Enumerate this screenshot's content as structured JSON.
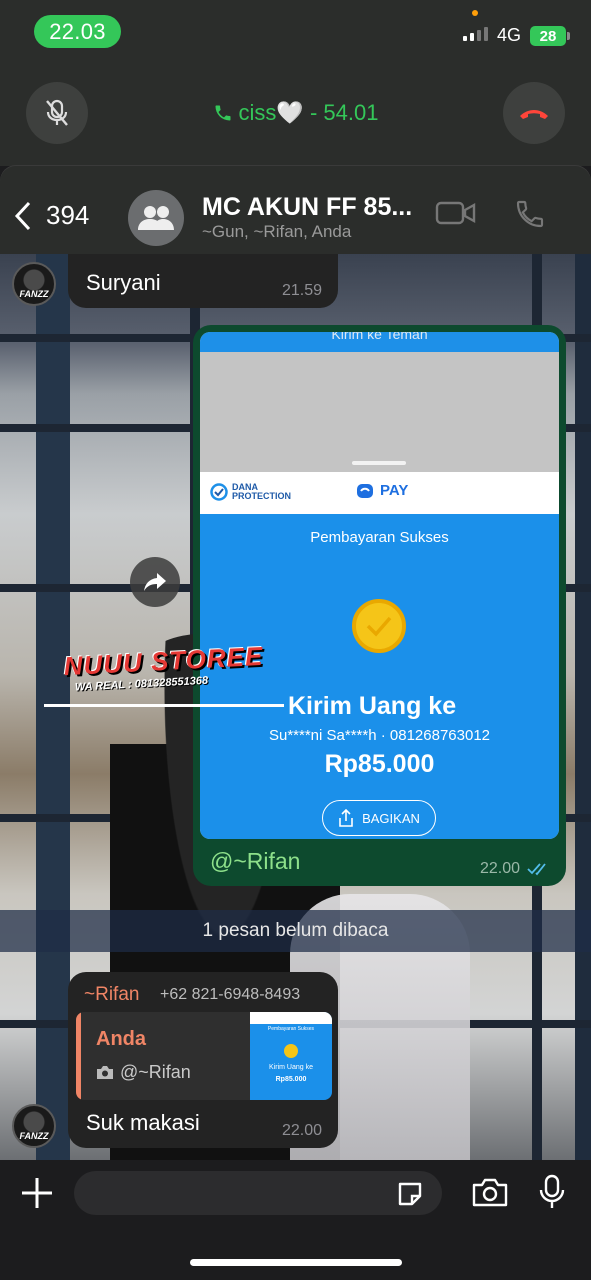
{
  "status_bar": {
    "time": "22.03",
    "network": "4G",
    "battery": "28"
  },
  "call_bar": {
    "caller": "ciss🤍 - 54.01"
  },
  "chat_header": {
    "unread_count": "394",
    "group_name": "MC AKUN FF 85...",
    "members": "~Gun, ~Rifan, Anda"
  },
  "messages": {
    "first": {
      "text": "Suryani",
      "time": "21.59"
    },
    "image_message": {
      "screenshot": {
        "top_text": "Kirim ke Teman",
        "dana_protection_line1": "DANA",
        "dana_protection_line2": "PROTECTION",
        "pay_label": "PAY",
        "status": "Pembayaran Sukses",
        "title": "Kirim Uang ke",
        "recipient": "Su****ni Sa****h · 081268763012",
        "amount": "Rp85.000",
        "share_label": "BAGIKAN"
      },
      "caption": "@~Rifan",
      "time": "22.00"
    },
    "watermark": {
      "brand": "NUUU STOREE",
      "contact": "WA REAL : 081328551368"
    },
    "unread_divider": "1 pesan belum dibaca",
    "reply": {
      "sender": "~Rifan",
      "phone": "+62 821-6948-8493",
      "quoted_name": "Anda",
      "quoted_caption": "@~Rifan",
      "thumb_status": "Pembayaran Sukses",
      "thumb_title": "Kirim Uang ke",
      "thumb_amount": "Rp85.000",
      "text": "Suk makasi",
      "time": "22.00"
    },
    "avatar_label": "FANZZ"
  },
  "colors": {
    "call_green": "#34c759",
    "hangup_red": "#ff453a",
    "dana_blue": "#1b90ea",
    "reply_accent": "#f08566",
    "outgoing_bubble": "#0d4a2e"
  }
}
